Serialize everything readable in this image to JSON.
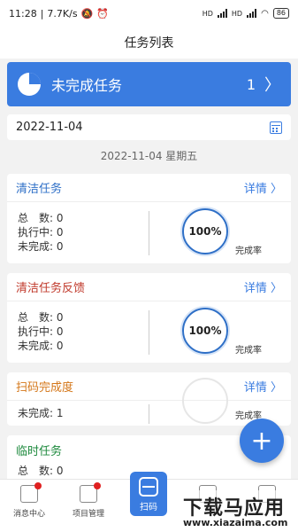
{
  "status_bar": {
    "time": "11:28",
    "speed": "7.7K/s",
    "signal_left": "HD",
    "signal_right": "HD",
    "battery": "86"
  },
  "header": {
    "title": "任务列表"
  },
  "banner": {
    "title": "未完成任务",
    "count": "1",
    "chevron": "〉"
  },
  "date_filter": {
    "value": "2022-11-04"
  },
  "day_header": "2022-11-04 星期五",
  "cards": [
    {
      "name": "清洁任务",
      "name_color": "#2e6fc7",
      "detail": "详情 〉",
      "stats": [
        {
          "label": "总　数: ",
          "value": "0"
        },
        {
          "label": "执行中: ",
          "value": "0"
        },
        {
          "label": "未完成: ",
          "value": "0"
        }
      ],
      "percent": "100%",
      "rate_label": "完成率"
    },
    {
      "name": "清洁任务反馈",
      "name_color": "#c0392b",
      "detail": "详情 〉",
      "stats": [
        {
          "label": "总　数: ",
          "value": "0"
        },
        {
          "label": "执行中: ",
          "value": "0"
        },
        {
          "label": "未完成: ",
          "value": "0"
        }
      ],
      "percent": "100%",
      "rate_label": "完成率"
    },
    {
      "name": "扫码完成度",
      "name_color": "#d4771a",
      "detail": "详情 〉",
      "stats": [
        {
          "label": "未完成: ",
          "value": "1"
        }
      ],
      "rate_label": "完成率"
    },
    {
      "name": "临时任务",
      "name_color": "#1e8a3e",
      "stats": [
        {
          "label": "总　数: ",
          "value": "0"
        }
      ]
    }
  ],
  "fab": {
    "icon": "+"
  },
  "bottom_nav": {
    "messages": "消息中心",
    "projects": "项目管理",
    "scan": "扫码"
  },
  "watermark": {
    "line1": "下载马应用",
    "line2": "www.xiazaima.com"
  }
}
